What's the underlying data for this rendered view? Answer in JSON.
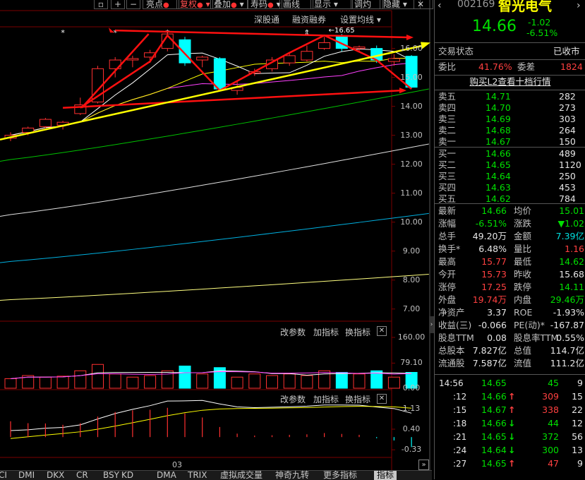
{
  "toolbar": {
    "items": [
      "亮点",
      "复权",
      "叠加",
      "寿码",
      "画线",
      "显示",
      "调灼",
      "隐藏"
    ],
    "active": "复权",
    "icons": [
      "file-icon",
      "plus-icon",
      "minus-icon"
    ]
  },
  "subbar": {
    "items": [
      "深股通",
      "融资融券",
      "设置均线"
    ]
  },
  "chart_data": {
    "type": "candlestick",
    "price_axis": [
      "16.00",
      "15.00",
      "14.00",
      "13.00",
      "12.00",
      "11.00",
      "10.00",
      "9.00",
      "8.00",
      "7.00"
    ],
    "price_range": [
      6.75,
      16.6
    ],
    "high_label": "16.65",
    "candles": [
      {
        "o": 12.9,
        "c": 13.0,
        "h": 13.1,
        "l": 12.8
      },
      {
        "o": 13.1,
        "c": 13.25,
        "h": 13.3,
        "l": 13.0
      },
      {
        "o": 13.3,
        "c": 13.55,
        "h": 13.6,
        "l": 13.25
      },
      {
        "o": 13.35,
        "c": 13.45,
        "h": 13.5,
        "l": 13.2
      },
      {
        "o": 13.75,
        "c": 14.05,
        "h": 14.3,
        "l": 13.7
      },
      {
        "o": 14.15,
        "c": 15.3,
        "h": 15.4,
        "l": 14.1
      },
      {
        "o": 15.3,
        "c": 15.6,
        "h": 15.7,
        "l": 15.0
      },
      {
        "o": 15.6,
        "c": 15.65,
        "h": 15.75,
        "l": 15.35
      },
      {
        "o": 15.7,
        "c": 15.85,
        "h": 15.95,
        "l": 15.5
      },
      {
        "o": 16.0,
        "c": 16.5,
        "h": 16.65,
        "l": 15.9
      },
      {
        "o": 16.3,
        "c": 15.5,
        "h": 16.4,
        "l": 15.4
      },
      {
        "o": 15.6,
        "c": 15.7,
        "h": 15.75,
        "l": 15.35
      },
      {
        "o": 15.65,
        "c": 14.6,
        "h": 15.7,
        "l": 14.55
      },
      {
        "o": 14.55,
        "c": 14.65,
        "h": 14.85,
        "l": 14.4
      },
      {
        "o": 15.15,
        "c": 15.2,
        "h": 15.3,
        "l": 15.05
      },
      {
        "o": 15.3,
        "c": 15.6,
        "h": 15.7,
        "l": 15.2
      },
      {
        "o": 15.5,
        "c": 15.75,
        "h": 15.85,
        "l": 15.4
      },
      {
        "o": 15.6,
        "c": 15.9,
        "h": 16.1,
        "l": 15.55
      },
      {
        "o": 16.0,
        "c": 16.2,
        "h": 16.4,
        "l": 15.95
      },
      {
        "o": 16.4,
        "c": 16.0,
        "h": 16.5,
        "l": 15.9
      },
      {
        "o": 16.0,
        "c": 16.05,
        "h": 16.1,
        "l": 15.9
      },
      {
        "o": 16.0,
        "c": 15.6,
        "h": 16.1,
        "l": 15.5
      },
      {
        "o": 15.55,
        "c": 15.65,
        "h": 15.8,
        "l": 15.4
      },
      {
        "o": 15.73,
        "c": 14.66,
        "h": 15.77,
        "l": 14.62
      }
    ],
    "markers": [
      "*",
      "*",
      "*",
      "⇕"
    ],
    "volume_axis": [
      "160.00",
      "79.10",
      "0.00"
    ],
    "volume_max": 160,
    "volumes": [
      30,
      40,
      35,
      38,
      55,
      75,
      45,
      35,
      40,
      55,
      70,
      45,
      65,
      35,
      45,
      40,
      45,
      40,
      55,
      50,
      45,
      55,
      35,
      50
    ],
    "indicator_axis": [
      "1.13",
      "0.40",
      "-0.33"
    ],
    "indicator_range": [
      -0.4,
      1.2
    ],
    "date_label": "03"
  },
  "panel_controls": [
    "改参数",
    "加指标",
    "换指标"
  ],
  "tabs": [
    "CI",
    "DMI",
    "DKX",
    "CR",
    "BSY",
    "KD",
    "DMA",
    "TRIX",
    "虚拟成交量",
    "神奇九转",
    "更多指标",
    "指标"
  ],
  "active_tab": "指标",
  "quote": {
    "code": "002169",
    "name": "智光电气",
    "price": "14.66",
    "change": "-1.02",
    "change_pct": "-6.51%",
    "status_label": "交易状态",
    "status_value": "已收市",
    "weibi_label": "委比",
    "weibi_value": "41.76%",
    "weicha_label": "委差",
    "weicha_value": "1824",
    "l2_link": "购买L2查看十档行情",
    "asks": [
      {
        "label": "卖五",
        "price": "14.71",
        "vol": "282"
      },
      {
        "label": "卖四",
        "price": "14.70",
        "vol": "273"
      },
      {
        "label": "卖三",
        "price": "14.69",
        "vol": "303"
      },
      {
        "label": "卖二",
        "price": "14.68",
        "vol": "264"
      },
      {
        "label": "卖一",
        "price": "14.67",
        "vol": "150"
      }
    ],
    "bids": [
      {
        "label": "买一",
        "price": "14.66",
        "vol": "489"
      },
      {
        "label": "买二",
        "price": "14.65",
        "vol": "1120"
      },
      {
        "label": "买三",
        "price": "14.64",
        "vol": "250"
      },
      {
        "label": "买四",
        "price": "14.63",
        "vol": "453"
      },
      {
        "label": "买五",
        "price": "14.62",
        "vol": "784"
      }
    ],
    "stats": [
      {
        "l1": "最新",
        "v1": "14.66",
        "c1": "green",
        "l2": "均价",
        "v2": "15.01",
        "c2": "green"
      },
      {
        "l1": "涨幅",
        "v1": "-6.51%",
        "c1": "green",
        "l2": "涨跌",
        "v2": "▼1.02",
        "c2": "green"
      },
      {
        "l1": "总手",
        "v1": "49.20万",
        "c1": "white",
        "l2": "金额",
        "v2": "7.39亿",
        "c2": "cyan"
      },
      {
        "l1": "换手*",
        "v1": "6.48%",
        "c1": "white",
        "l2": "量比",
        "v2": "1.16",
        "c2": "red"
      },
      {
        "l1": "最高",
        "v1": "15.77",
        "c1": "red",
        "l2": "最低",
        "v2": "14.62",
        "c2": "green"
      },
      {
        "l1": "今开",
        "v1": "15.73",
        "c1": "red",
        "l2": "昨收",
        "v2": "15.68",
        "c2": "white"
      },
      {
        "l1": "涨停",
        "v1": "17.25",
        "c1": "red",
        "l2": "跌停",
        "v2": "14.11",
        "c2": "green"
      },
      {
        "l1": "外盘",
        "v1": "19.74万",
        "c1": "red",
        "l2": "内盘",
        "v2": "29.46万",
        "c2": "green"
      },
      {
        "l1": "净资产",
        "v1": "3.37",
        "c1": "white",
        "l2": "ROE",
        "v2": "-1.93%",
        "c2": "white"
      },
      {
        "l1": "收益(三)",
        "v1": "-0.066",
        "c1": "white",
        "l2": "PE(动)*",
        "v2": "-167.87",
        "c2": "white"
      },
      {
        "l1": "股息TTM",
        "v1": "0.08",
        "c1": "white",
        "l2": "股息率TTM",
        "v2": "0.55%",
        "c2": "white"
      },
      {
        "l1": "总股本",
        "v1": "7.827亿",
        "c1": "white",
        "l2": "总值",
        "v2": "114.7亿",
        "c2": "white"
      },
      {
        "l1": "流通股",
        "v1": "7.587亿",
        "c1": "white",
        "l2": "流值",
        "v2": "111.2亿",
        "c2": "white"
      }
    ],
    "ticks": [
      {
        "time": "14:56",
        "price": "14.65",
        "arrow": "",
        "vol": "45",
        "vc": "green",
        "n": "9"
      },
      {
        "time": ":12",
        "price": "14.66",
        "arrow": "↑",
        "ac": "red",
        "vol": "309",
        "vc": "red",
        "n": "15"
      },
      {
        "time": ":15",
        "price": "14.67",
        "arrow": "↑",
        "ac": "red",
        "vol": "338",
        "vc": "red",
        "n": "22"
      },
      {
        "time": ":18",
        "price": "14.66",
        "arrow": "↓",
        "ac": "green",
        "vol": "44",
        "vc": "green",
        "n": "12"
      },
      {
        "time": ":21",
        "price": "14.65",
        "arrow": "↓",
        "ac": "green",
        "vol": "372",
        "vc": "green",
        "n": "56"
      },
      {
        "time": ":24",
        "price": "14.64",
        "arrow": "↓",
        "ac": "green",
        "vol": "300",
        "vc": "green",
        "n": "13"
      },
      {
        "time": ":27",
        "price": "14.65",
        "arrow": "↑",
        "ac": "red",
        "vol": "47",
        "vc": "red",
        "n": "9"
      }
    ]
  }
}
